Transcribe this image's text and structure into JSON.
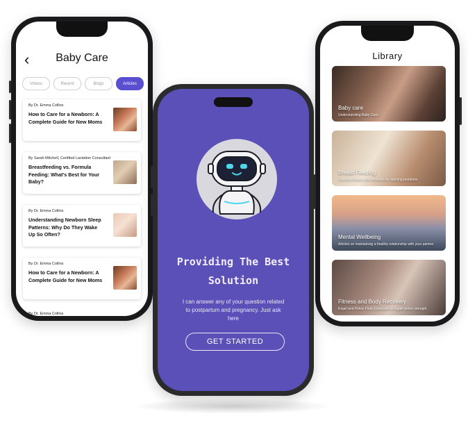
{
  "left_screen": {
    "title": "Baby Care",
    "back_icon": "chevron-left-icon",
    "tabs": [
      {
        "label": "Videos",
        "active": false
      },
      {
        "label": "Recent",
        "active": false
      },
      {
        "label": "Blogs",
        "active": false
      },
      {
        "label": "Articles",
        "active": true
      }
    ],
    "articles": [
      {
        "author": "By Dr. Emma Collins",
        "title": "How to Care for a Newborn: A Complete Guide for New Moms"
      },
      {
        "author": "By Sarah Mitchell, Certified Lactation Consultant",
        "title": "Breastfeeding vs. Formula Feeding: What's Best for Your Baby?"
      },
      {
        "author": "By Dr. Emma Collins",
        "title": "Understanding Newborn Sleep Patterns: Why Do They Wake Up So Often?"
      },
      {
        "author": "By Dr. Emma Collins",
        "title": "How to Care for a Newborn: A Complete Guide for New Moms"
      }
    ],
    "tail_author": "By Dr. Emma Collins"
  },
  "center_screen": {
    "heading_line1": "Providing The Best",
    "heading_line2": "Solution",
    "description": "I can answer any of your question related to postpartum and pregnancy. Just ask here",
    "cta_label": "GET STARTED",
    "robot_icon": "robot-icon"
  },
  "right_screen": {
    "title": "Library",
    "items": [
      {
        "title": "Baby care",
        "subtitle": "Understanding Baby Care"
      },
      {
        "title": "Breast Feeding",
        "subtitle": "Common issues and solutions for latching problems"
      },
      {
        "title": "Mental Wellbeing",
        "subtitle": "Articles on maintaining a healthy relationship with your partner"
      },
      {
        "title": "Fitness and Body Recovery",
        "subtitle": "Kegel and Pelvic Floor Exercises to regain pelvic strength"
      }
    ]
  },
  "colors": {
    "accent": "#5b4fd1",
    "center_bg": "#5b4fb8"
  }
}
